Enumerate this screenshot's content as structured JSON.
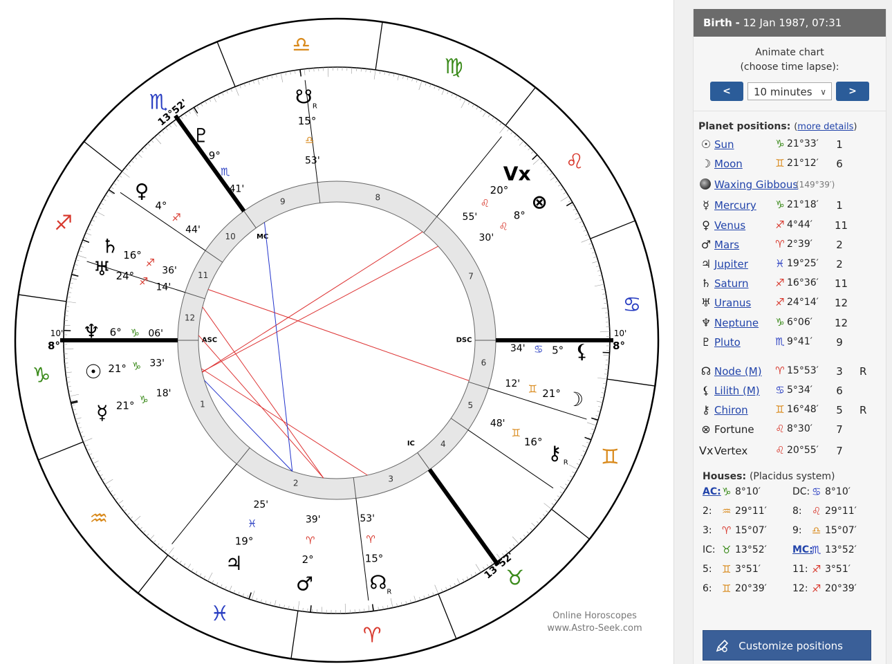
{
  "header": {
    "event": "Birth",
    "separator": "-",
    "datetime": "12 Jan 1987, 07:31"
  },
  "animate": {
    "line1": "Animate chart",
    "line2": "(choose time lapse):",
    "prev_label": "<",
    "next_label": ">",
    "interval": "10 minutes",
    "caret": "∨"
  },
  "planets_section": {
    "title": "Planet positions:",
    "link_paren_open": "(",
    "link": "more details",
    "link_paren_close": ")"
  },
  "planets": [
    {
      "glyph": "☉",
      "name": "Sun",
      "sign": "♑",
      "sign_color": "#3a8a1a",
      "deg": "21°33′",
      "house": "1",
      "retro": ""
    },
    {
      "glyph": "☽",
      "name": "Moon",
      "sign": "♊",
      "sign_color": "#d98a1c",
      "deg": "21°12′",
      "house": "6",
      "retro": ""
    }
  ],
  "moon_phase": {
    "name": "Waxing Gibbous",
    "angle": "(149°39′)"
  },
  "planets2": [
    {
      "glyph": "☿",
      "name": "Mercury",
      "sign": "♑",
      "sign_color": "#3a8a1a",
      "deg": "21°18′",
      "house": "1",
      "retro": ""
    },
    {
      "glyph": "♀",
      "name": "Venus",
      "sign": "♐",
      "sign_color": "#d8392e",
      "deg": "4°44′",
      "house": "11",
      "retro": ""
    },
    {
      "glyph": "♂",
      "name": "Mars",
      "sign": "♈",
      "sign_color": "#d8392e",
      "deg": "2°39′",
      "house": "2",
      "retro": ""
    },
    {
      "glyph": "♃",
      "name": "Jupiter",
      "sign": "♓",
      "sign_color": "#2a3fc2",
      "deg": "19°25′",
      "house": "2",
      "retro": ""
    },
    {
      "glyph": "♄",
      "name": "Saturn",
      "sign": "♐",
      "sign_color": "#d8392e",
      "deg": "16°36′",
      "house": "11",
      "retro": ""
    },
    {
      "glyph": "♅",
      "name": "Uranus",
      "sign": "♐",
      "sign_color": "#d8392e",
      "deg": "24°14′",
      "house": "12",
      "retro": ""
    },
    {
      "glyph": "♆",
      "name": "Neptune",
      "sign": "♑",
      "sign_color": "#3a8a1a",
      "deg": "6°06′",
      "house": "12",
      "retro": ""
    },
    {
      "glyph": "♇",
      "name": "Pluto",
      "sign": "♏",
      "sign_color": "#2a3fc2",
      "deg": "9°41′",
      "house": "9",
      "retro": ""
    }
  ],
  "points": [
    {
      "glyph": "☊",
      "name": "Node (M)",
      "sign": "♈",
      "sign_color": "#d8392e",
      "deg": "15°53′",
      "house": "3",
      "retro": "R",
      "link": true
    },
    {
      "glyph": "⚸",
      "name": "Lilith (M)",
      "sign": "♋",
      "sign_color": "#2a3fc2",
      "deg": "5°34′",
      "house": "6",
      "retro": "",
      "link": true
    },
    {
      "glyph": "⚷",
      "name": "Chiron",
      "sign": "♊",
      "sign_color": "#d98a1c",
      "deg": "16°48′",
      "house": "5",
      "retro": "R",
      "link": true
    },
    {
      "glyph": "⊗",
      "name": "Fortune",
      "sign": "♌",
      "sign_color": "#d8392e",
      "deg": "8°30′",
      "house": "7",
      "retro": "",
      "link": false
    },
    {
      "glyph": "Vx",
      "name": "Vertex",
      "sign": "♌",
      "sign_color": "#d8392e",
      "deg": "20°55′",
      "house": "7",
      "retro": "",
      "link": false
    }
  ],
  "houses_section": {
    "title": "Houses:",
    "system": "(Placidus system)"
  },
  "houses": [
    {
      "key": "AC:",
      "link": true,
      "sign": "♑",
      "sign_color": "#3a8a1a",
      "deg": "8°10′"
    },
    {
      "key": "DC:",
      "link": false,
      "sign": "♋",
      "sign_color": "#2a3fc2",
      "deg": "8°10′"
    },
    {
      "key": "2:",
      "link": false,
      "sign": "♒",
      "sign_color": "#d98a1c",
      "deg": "29°11′"
    },
    {
      "key": "8:",
      "link": false,
      "sign": "♌",
      "sign_color": "#d8392e",
      "deg": "29°11′"
    },
    {
      "key": "3:",
      "link": false,
      "sign": "♈",
      "sign_color": "#d8392e",
      "deg": "15°07′"
    },
    {
      "key": "9:",
      "link": false,
      "sign": "♎",
      "sign_color": "#d98a1c",
      "deg": "15°07′"
    },
    {
      "key": "IC:",
      "link": false,
      "sign": "♉",
      "sign_color": "#3a8a1a",
      "deg": "13°52′"
    },
    {
      "key": "MC:",
      "link": true,
      "sign": "♏",
      "sign_color": "#2a3fc2",
      "deg": "13°52′"
    },
    {
      "key": "5:",
      "link": false,
      "sign": "♊",
      "sign_color": "#d98a1c",
      "deg": "3°51′"
    },
    {
      "key": "11:",
      "link": false,
      "sign": "♐",
      "sign_color": "#d8392e",
      "deg": "3°51′"
    },
    {
      "key": "6:",
      "link": false,
      "sign": "♊",
      "sign_color": "#d98a1c",
      "deg": "20°39′"
    },
    {
      "key": "12:",
      "link": false,
      "sign": "♐",
      "sign_color": "#d8392e",
      "deg": "20°39′"
    }
  ],
  "customize_label": "Customize positions",
  "credit": {
    "line1": "Online Horoscopes",
    "line2": "www.Astro-Seek.com"
  },
  "wheel": {
    "zodiac": [
      {
        "glyph": "♈",
        "color": "#d8392e"
      },
      {
        "glyph": "♉",
        "color": "#3a8a1a"
      },
      {
        "glyph": "♊",
        "color": "#d98a1c"
      },
      {
        "glyph": "♋",
        "color": "#2a3fc2"
      },
      {
        "glyph": "♌",
        "color": "#d8392e"
      },
      {
        "glyph": "♍",
        "color": "#3a8a1a"
      },
      {
        "glyph": "♎",
        "color": "#d98a1c"
      },
      {
        "glyph": "♏",
        "color": "#2a3fc2"
      },
      {
        "glyph": "♐",
        "color": "#d8392e"
      },
      {
        "glyph": "♑",
        "color": "#3a8a1a"
      },
      {
        "glyph": "♒",
        "color": "#d98a1c"
      },
      {
        "glyph": "♓",
        "color": "#2a3fc2"
      }
    ],
    "asc_label": "ASC",
    "dsc_label": "DSC",
    "mc_label": "MC",
    "ic_label": "IC",
    "asc_deg": "8°",
    "asc_min": "10'",
    "dsc_deg": "8°",
    "dsc_min": "10'",
    "mc_text": "13°52'",
    "ic_text": "13°52'",
    "house_numbers": [
      "1",
      "2",
      "3",
      "4",
      "5",
      "6",
      "7",
      "8",
      "9",
      "10",
      "11",
      "12"
    ],
    "bodies": [
      {
        "key": "sun",
        "glyph": "☉",
        "deg": "21°",
        "sign": "♑",
        "sign_color": "#3a8a1a",
        "min": "33'",
        "r": ""
      },
      {
        "key": "moon",
        "glyph": "☽",
        "deg": "21°",
        "sign": "♊",
        "sign_color": "#d98a1c",
        "min": "12'",
        "r": ""
      },
      {
        "key": "mercury",
        "glyph": "☿",
        "deg": "21°",
        "sign": "♑",
        "sign_color": "#3a8a1a",
        "min": "18'",
        "r": ""
      },
      {
        "key": "venus",
        "glyph": "♀",
        "deg": "4°",
        "sign": "♐",
        "sign_color": "#d8392e",
        "min": "44'",
        "r": ""
      },
      {
        "key": "mars",
        "glyph": "♂",
        "deg": "2°",
        "sign": "♈",
        "sign_color": "#d8392e",
        "min": "39'",
        "r": ""
      },
      {
        "key": "jupiter",
        "glyph": "♃",
        "deg": "19°",
        "sign": "♓",
        "sign_color": "#2a3fc2",
        "min": "25'",
        "r": ""
      },
      {
        "key": "saturn",
        "glyph": "♄",
        "deg": "16°",
        "sign": "♐",
        "sign_color": "#d8392e",
        "min": "36'",
        "r": ""
      },
      {
        "key": "uranus",
        "glyph": "♅",
        "deg": "24°",
        "sign": "♐",
        "sign_color": "#d8392e",
        "min": "14'",
        "r": ""
      },
      {
        "key": "neptune",
        "glyph": "♆",
        "deg": "6°",
        "sign": "♑",
        "sign_color": "#3a8a1a",
        "min": "06'",
        "r": ""
      },
      {
        "key": "pluto",
        "glyph": "♇",
        "deg": "9°",
        "sign": "♏",
        "sign_color": "#2a3fc2",
        "min": "41'",
        "r": ""
      },
      {
        "key": "node",
        "glyph": "☊",
        "deg": "15°",
        "sign": "♈",
        "sign_color": "#d8392e",
        "min": "53'",
        "r": "R"
      },
      {
        "key": "south-node",
        "glyph": "☋",
        "deg": "15°",
        "sign": "♎",
        "sign_color": "#d98a1c",
        "min": "53'",
        "r": "R"
      },
      {
        "key": "lilith",
        "glyph": "⚸",
        "deg": "5°",
        "sign": "♋",
        "sign_color": "#2a3fc2",
        "min": "34'",
        "r": ""
      },
      {
        "key": "chiron",
        "glyph": "⚷",
        "deg": "16°",
        "sign": "♊",
        "sign_color": "#d98a1c",
        "min": "48'",
        "r": "R"
      },
      {
        "key": "fortune",
        "glyph": "⊗",
        "deg": "8°",
        "sign": "♌",
        "sign_color": "#d8392e",
        "min": "30'",
        "r": ""
      },
      {
        "key": "vertex",
        "glyph": "Vx",
        "deg": "20°",
        "sign": "♌",
        "sign_color": "#d8392e",
        "min": "55'",
        "r": ""
      }
    ]
  }
}
